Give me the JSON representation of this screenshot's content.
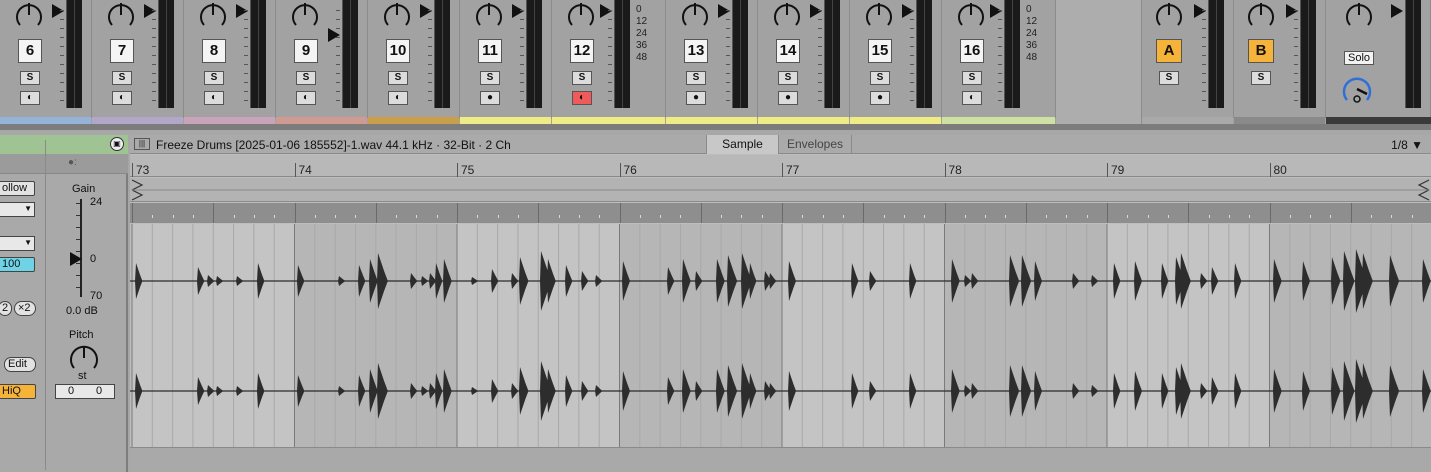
{
  "mixer": {
    "tracks": [
      {
        "num": "6",
        "color": "#95b3d8",
        "mon": "◐",
        "mon_active": false
      },
      {
        "num": "7",
        "color": "#b3a7c9",
        "mon": "◐",
        "mon_active": false
      },
      {
        "num": "8",
        "color": "#c9a3b8",
        "mon": "◐",
        "mon_active": false
      },
      {
        "num": "9",
        "color": "#cf9a92",
        "mon": "◐",
        "mon_active": false
      },
      {
        "num": "10",
        "color": "#c99f4a",
        "mon": "◐",
        "mon_active": false
      },
      {
        "num": "11",
        "color": "#f0ec85",
        "mon": "●",
        "mon_active": false
      },
      {
        "num": "12",
        "color": "#f0ec85",
        "mon": "◐",
        "mon_active": true
      },
      {
        "num": "13",
        "color": "#f0ec85",
        "mon": "●",
        "mon_active": false
      },
      {
        "num": "14",
        "color": "#f0ec85",
        "mon": "●",
        "mon_active": false
      },
      {
        "num": "15",
        "color": "#f0ec85",
        "mon": "●",
        "mon_active": false
      },
      {
        "num": "16",
        "color": "#cfe0a3",
        "mon": "◐",
        "mon_active": false
      }
    ],
    "solo_label": "S",
    "db_scale": [
      "0",
      "12",
      "24",
      "36",
      "48"
    ],
    "returns": [
      {
        "letter": "A",
        "color": "#a9a9a9"
      },
      {
        "letter": "B",
        "color": "#8a8a8a"
      }
    ],
    "master": {
      "solo_label": "Solo",
      "color": "#3a3a3a"
    }
  },
  "left_panel": {
    "follow_label": "ollow",
    "transpose_value": "100",
    "x2_label": "×2",
    "half_label": "2",
    "edit_label": "Edit",
    "hiq_label": "HiQ",
    "gain_label": "Gain",
    "gain_max": "24",
    "gain_mid": "0",
    "gain_min": "70",
    "gain_value": "0.0 dB",
    "pitch_label": "Pitch",
    "pitch_unit": "st",
    "pitch_semi": "0",
    "pitch_cent": "0"
  },
  "clip": {
    "title": "Freeze Drums [2025-01-06 185552]-1.wav  44.1 kHz · 32-Bit · 2 Ch",
    "tabs": [
      "Sample",
      "Envelopes"
    ],
    "grid": "1/8 ▼",
    "bars": [
      "73",
      "74",
      "75",
      "76",
      "77",
      "78",
      "79",
      "80"
    ]
  }
}
